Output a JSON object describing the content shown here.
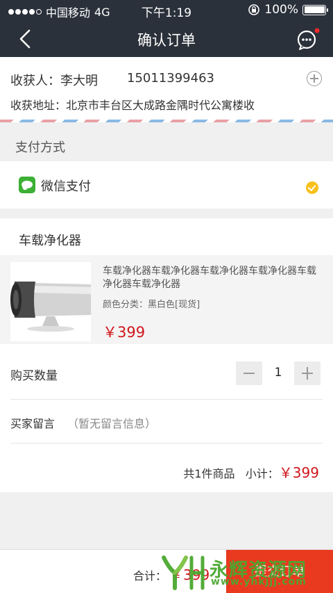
{
  "status_bar": {
    "carrier": "中国移动",
    "network": "4G",
    "time": "下午1:19",
    "battery": "100%"
  },
  "nav": {
    "title": "确认订单",
    "back_icon": "back-chevron-icon",
    "chat_icon": "chat-bubble-icon"
  },
  "address": {
    "receiver_label": "收获人：",
    "receiver_name": "李大明",
    "phone": "15011399463",
    "address_label": "收获地址：",
    "address": "北京市丰台区大成路金隅时代公寓楼收"
  },
  "payment": {
    "section_title": "支付方式",
    "method_label": "微信支付",
    "method_selected": true
  },
  "shop": {
    "name": "车载净化器",
    "product": {
      "name": "车载净化器车载净化器车载净化器车载净化器车载净化器车载净化器",
      "spec": "颜色分类：黑白色[现货]",
      "price": "￥399"
    },
    "quantity_label": "购买数量",
    "quantity": "1",
    "note_label": "买家留言",
    "note_placeholder": "（暂无留言信息）",
    "summary_count": "共1件商品",
    "summary_label": "小计：",
    "summary_price": "￥399"
  },
  "bottom": {
    "total_label": "合计：",
    "total_price": "￥399",
    "submit_label": "提交订单"
  },
  "watermark": {
    "text": "永辉资源网",
    "url": "www.yhkjjj.com"
  },
  "colors": {
    "header_bg": "#2b313b",
    "price_red": "#d0161c",
    "submit_bg": "#e93a1f",
    "wechat_green": "#3cb034",
    "check_yellow": "#f7c01c"
  }
}
